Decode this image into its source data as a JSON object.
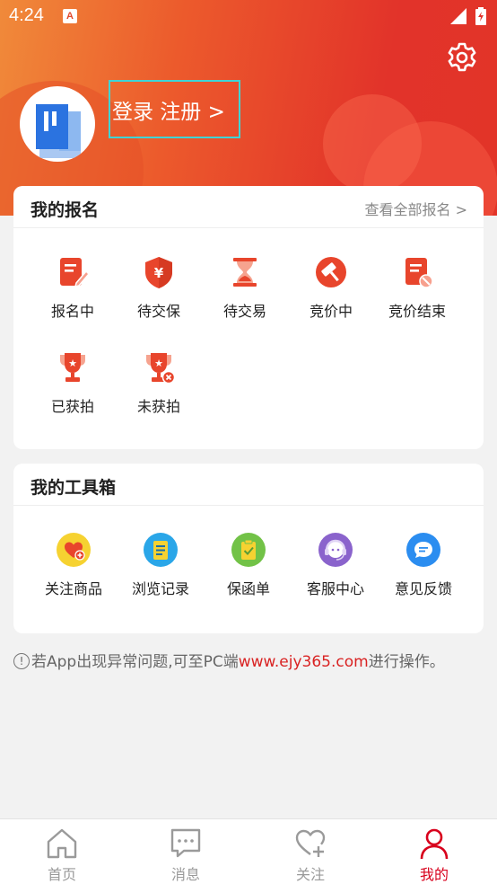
{
  "status_bar": {
    "time": "4:24",
    "notification_badge": "A"
  },
  "header": {
    "login_register": "登录 注册 >",
    "settings_icon": "gear-icon"
  },
  "signup_card": {
    "title": "我的报名",
    "view_all": "查看全部报名 >",
    "items": [
      {
        "label": "报名中",
        "icon": "form-edit-icon"
      },
      {
        "label": "待交保",
        "icon": "yuan-shield-icon"
      },
      {
        "label": "待交易",
        "icon": "hourglass-icon"
      },
      {
        "label": "竞价中",
        "icon": "gavel-icon"
      },
      {
        "label": "竞价结束",
        "icon": "document-ban-icon"
      },
      {
        "label": "已获拍",
        "icon": "trophy-icon"
      },
      {
        "label": "未获拍",
        "icon": "trophy-x-icon"
      }
    ]
  },
  "tools_card": {
    "title": "我的工具箱",
    "items": [
      {
        "label": "关注商品",
        "icon": "heart-plus-icon",
        "color": "#f6d231"
      },
      {
        "label": "浏览记录",
        "icon": "notepad-icon",
        "color": "#2aa6e8"
      },
      {
        "label": "保函单",
        "icon": "clipboard-check-icon",
        "color": "#72c247"
      },
      {
        "label": "客服中心",
        "icon": "headset-icon",
        "color": "#8a63cc"
      },
      {
        "label": "意见反馈",
        "icon": "chat-bubble-icon",
        "color": "#2b8df0"
      }
    ]
  },
  "notice": {
    "prefix": "若App出现异常问题,可至PC端",
    "link": "www.ejy365.com",
    "suffix": "进行操作。"
  },
  "tabbar": {
    "tabs": [
      {
        "label": "首页",
        "icon": "home-icon"
      },
      {
        "label": "消息",
        "icon": "message-icon"
      },
      {
        "label": "关注",
        "icon": "heart-plus-icon"
      },
      {
        "label": "我的",
        "icon": "user-icon",
        "active": true
      }
    ]
  },
  "colors": {
    "accent": "#d8001c",
    "icon_red": "#e8452c",
    "header_start": "#f08a3a",
    "header_end": "#e23428"
  }
}
